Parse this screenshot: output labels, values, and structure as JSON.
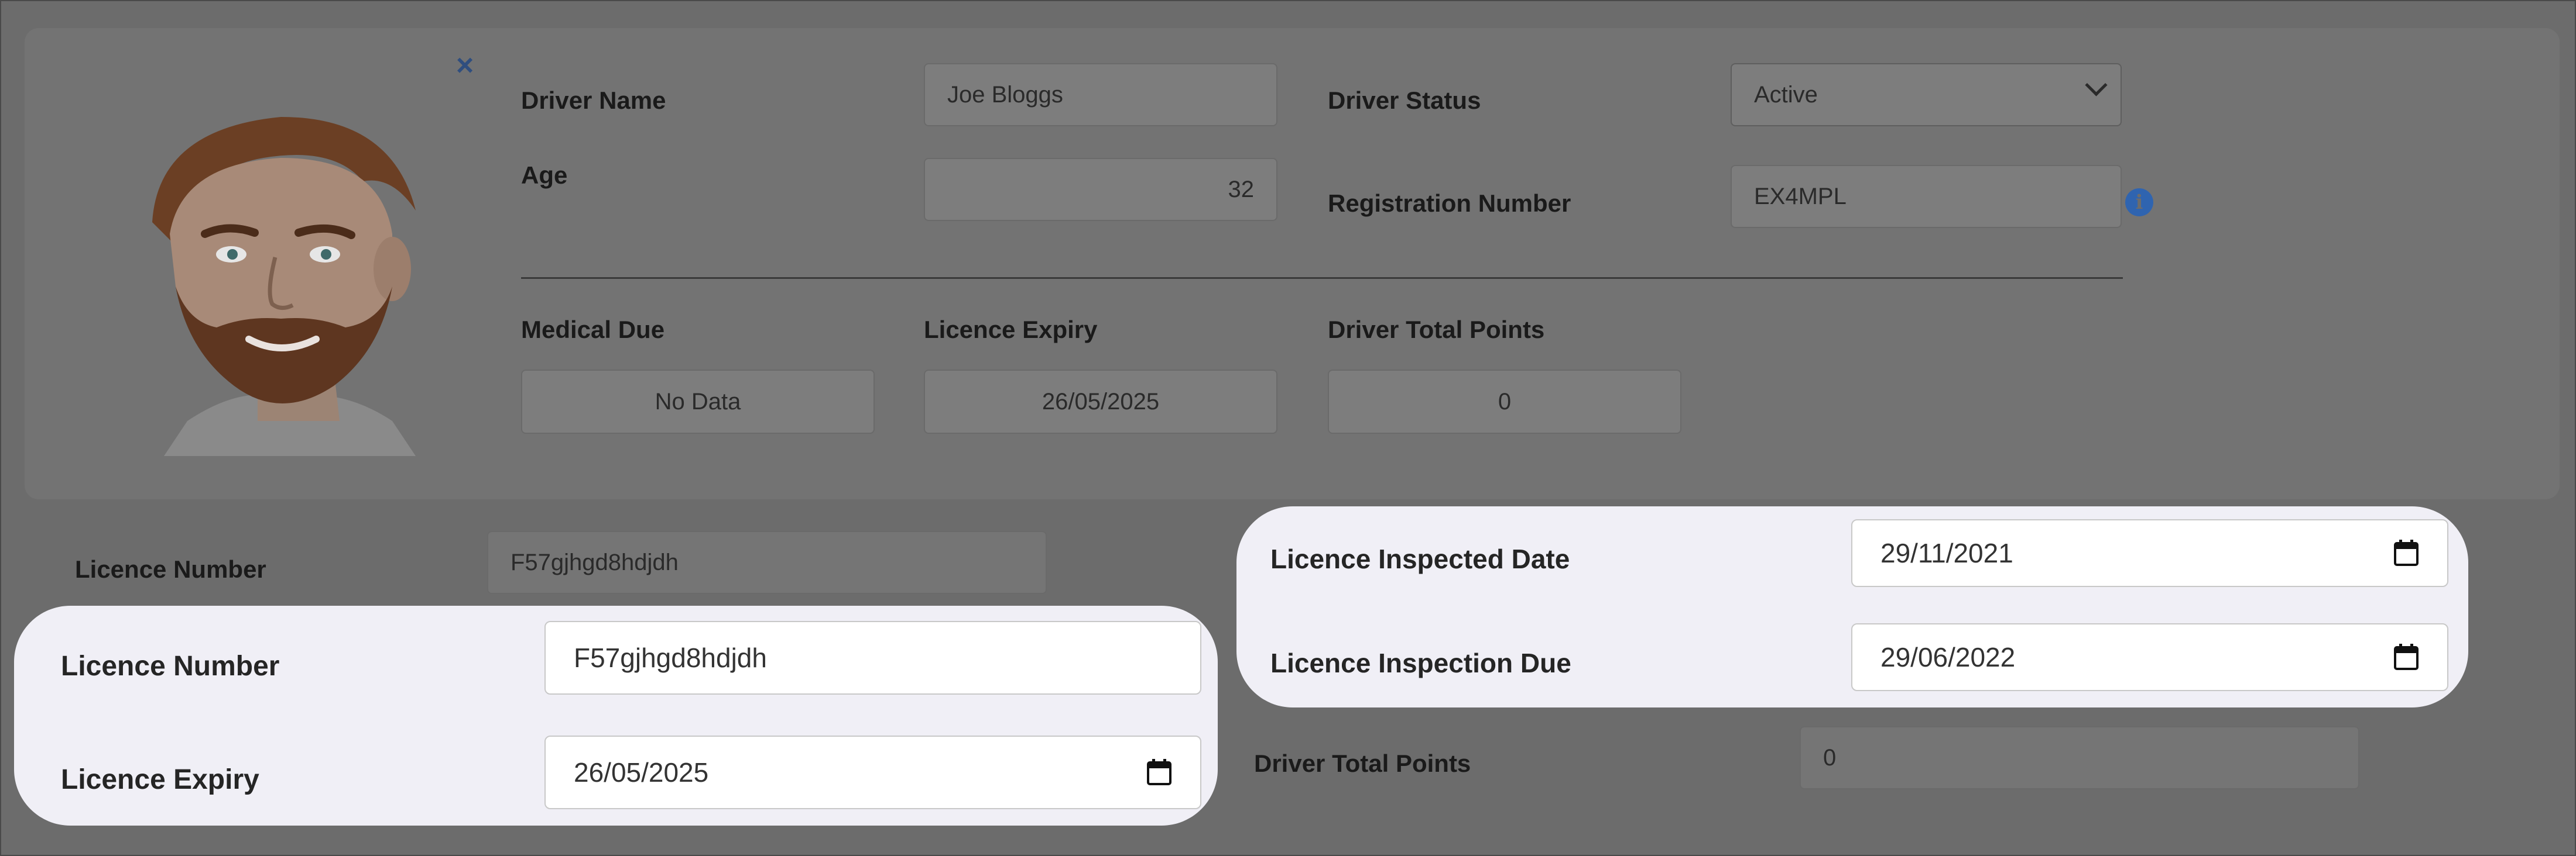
{
  "driver_card": {
    "driver_name_label": "Driver Name",
    "driver_name_value": "Joe Bloggs",
    "age_label": "Age",
    "age_value": "32",
    "driver_status_label": "Driver Status",
    "driver_status_value": "Active",
    "registration_label": "Registration Number",
    "registration_value": "EX4MPL",
    "medical_due_label": "Medical Due",
    "medical_due_value": "No Data",
    "licence_expiry_label": "Licence Expiry",
    "licence_expiry_value": "26/05/2025",
    "total_points_label": "Driver Total Points",
    "total_points_value": "0"
  },
  "background_form": {
    "licence_number_label": "Licence Number",
    "licence_number_value": "F57gjhgd8hdjdh",
    "total_points_label": "Driver Total Points",
    "total_points_value": "0"
  },
  "highlight_left": {
    "licence_number_label": "Licence Number",
    "licence_number_value": "F57gjhgd8hdjdh",
    "licence_expiry_label": "Licence Expiry",
    "licence_expiry_value": "26/05/2025"
  },
  "highlight_right": {
    "inspected_date_label": "Licence Inspected Date",
    "inspected_date_value": "29/11/2021",
    "inspection_due_label": "Licence Inspection Due",
    "inspection_due_value": "29/06/2022"
  },
  "icons": {
    "close": "close-icon",
    "menu": "kebab-menu-icon",
    "info": "info-icon",
    "calendar": "calendar-icon"
  },
  "colors": {
    "accent": "#2f4e7f",
    "info": "#2f64b0",
    "overlay": "#6c6c6c",
    "highlight": "#f0eff6"
  }
}
